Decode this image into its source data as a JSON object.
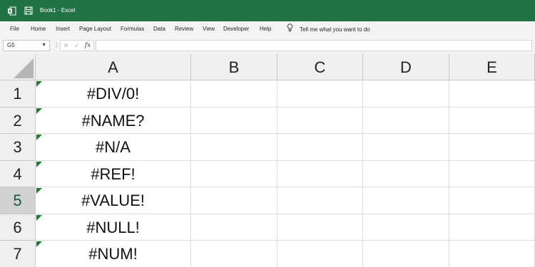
{
  "window": {
    "title": "Book1  -  Excel",
    "brand_color": "#217346",
    "icons": [
      "excel-logo-icon",
      "save-icon"
    ]
  },
  "ribbon": {
    "tabs": [
      "File",
      "Home",
      "Insert",
      "Page Layout",
      "Formulas",
      "Data",
      "Review",
      "View",
      "Developer",
      "Help"
    ],
    "tell_me": "Tell me what you want to do",
    "tell_me_icon": "lightbulb-icon"
  },
  "formula_bar": {
    "name_box": "G5",
    "fx_label": "fx",
    "value": ""
  },
  "sheet": {
    "columns": [
      "A",
      "B",
      "C",
      "D",
      "E"
    ],
    "rows": [
      "1",
      "2",
      "3",
      "4",
      "5",
      "6",
      "7"
    ],
    "selected_row": "5",
    "column_a": [
      "#DIV/0!",
      "#NAME?",
      "#N/A",
      "#REF!",
      "#VALUE!",
      "#NULL!",
      "#NUM!"
    ],
    "error_indicator_color": "#1e7b34"
  }
}
